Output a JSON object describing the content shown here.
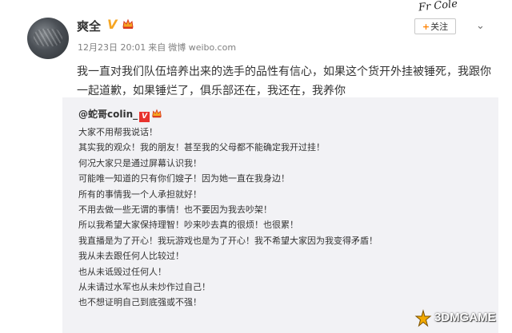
{
  "post": {
    "author": "爽全",
    "verified_badge": "V",
    "meta": {
      "time": "12月23日 20:01",
      "source_prefix": "来自",
      "source": "微博 weibo.com"
    },
    "follow_label": "关注",
    "follow_plus": "+",
    "dropdown_glyph": "⌄",
    "signature": "Fr Cole",
    "text": "我一直对我们队伍培养出来的选手的品性有信心，如果这个货开外挂被锤死，我跟你一起道歉，如果锤烂了，俱乐部还在，我还在，我养你"
  },
  "repost": {
    "author": "@蛇哥colin_",
    "badge": "V",
    "lines": [
      "大家不用帮我说话！",
      "其实我的观众！我的朋友！甚至我的父母都不能确定我开过挂！",
      "何况大家只是通过屏幕认识我！",
      "可能唯一知道的只有你们嫂子！因为她一直在我身边！",
      "所有的事情我一个人承担就好！",
      "不用去做一些无谓的事情！也不要因为我去吵架！",
      "所以我希望大家保持理智！吵来吵去真的很烦！也很累！",
      "我直播是为了开心！我玩游戏也是为了开心！我不希望大家因为我变得矛盾！",
      "我从未去跟任何人比较过！",
      "也从未诋毁过任何人！",
      "从未请过水军也从未炒作过自己！",
      "也不想证明自己到底强或不强！"
    ]
  },
  "watermark": {
    "text": "3DMGAME"
  },
  "colors": {
    "verified": "#f6a623",
    "follow_plus": "#ff8200",
    "repost_bg": "#f2f2f5",
    "repost_badge": "#e8332e"
  },
  "icons": [
    "avatar",
    "verified-icon",
    "crown-icon",
    "chevron-down-icon",
    "watermark-logo-icon"
  ]
}
